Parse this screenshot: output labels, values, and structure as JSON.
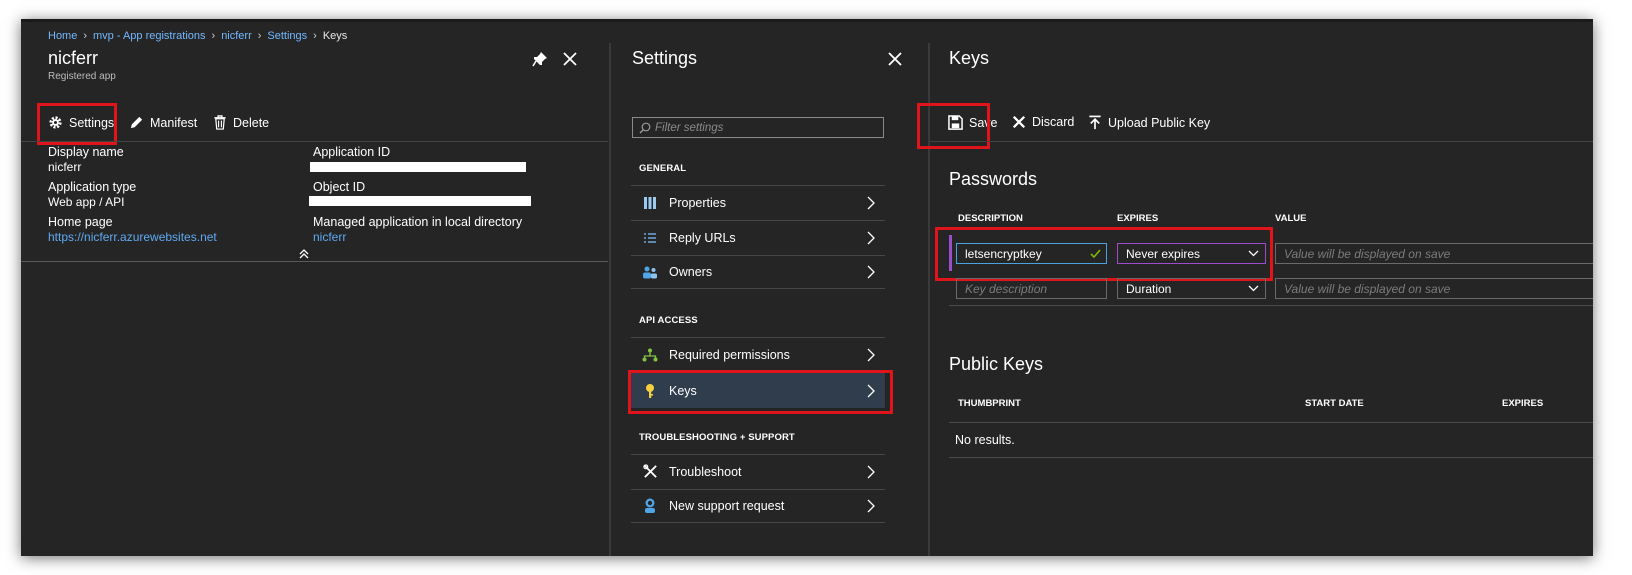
{
  "breadcrumb": {
    "items": [
      "Home",
      "mvp - App registrations",
      "nicferr",
      "Settings",
      "Keys"
    ]
  },
  "app_blade": {
    "title": "nicferr",
    "subtitle": "Registered app",
    "commands": {
      "settings": "Settings",
      "manifest": "Manifest",
      "delete": "Delete"
    },
    "properties": {
      "display_name_label": "Display name",
      "display_name_value": "nicferr",
      "app_type_label": "Application type",
      "app_type_value": "Web app / API",
      "home_page_label": "Home page",
      "home_page_value": "https://nicferr.azurewebsites.net",
      "app_id_label": "Application ID",
      "object_id_label": "Object ID",
      "managed_app_label": "Managed application in local directory",
      "managed_app_value": "nicferr"
    }
  },
  "settings_blade": {
    "title": "Settings",
    "search_placeholder": "Filter settings",
    "sections": {
      "general": "GENERAL",
      "api_access": "API ACCESS",
      "troubleshooting": "TROUBLESHOOTING + SUPPORT"
    },
    "items": {
      "properties": "Properties",
      "reply_urls": "Reply URLs",
      "owners": "Owners",
      "required_permissions": "Required permissions",
      "keys": "Keys",
      "troubleshoot": "Troubleshoot",
      "new_support_request": "New support request"
    },
    "selected_item": "Keys"
  },
  "keys_blade": {
    "title": "Keys",
    "commands": {
      "save": "Save",
      "discard": "Discard",
      "upload": "Upload Public Key"
    },
    "passwords": {
      "title": "Passwords",
      "columns": [
        "DESCRIPTION",
        "EXPIRES",
        "VALUE"
      ],
      "rows": [
        {
          "description": "letsencryptkey",
          "expires": "Never expires",
          "value_placeholder": "Value will be displayed on save"
        },
        {
          "description_placeholder": "Key description",
          "expires": "Duration",
          "value_placeholder": "Value will be displayed on save"
        }
      ]
    },
    "public_keys": {
      "title": "Public Keys",
      "columns": [
        "THUMBPRINT",
        "START DATE",
        "EXPIRES"
      ],
      "empty_text": "No results."
    }
  },
  "colors": {
    "background": "#252525",
    "link": "#5ea9f2",
    "highlight_box": "#e0151b",
    "selected_row": "#2f3d4d",
    "active_row_marker": "#9c4dcc"
  }
}
